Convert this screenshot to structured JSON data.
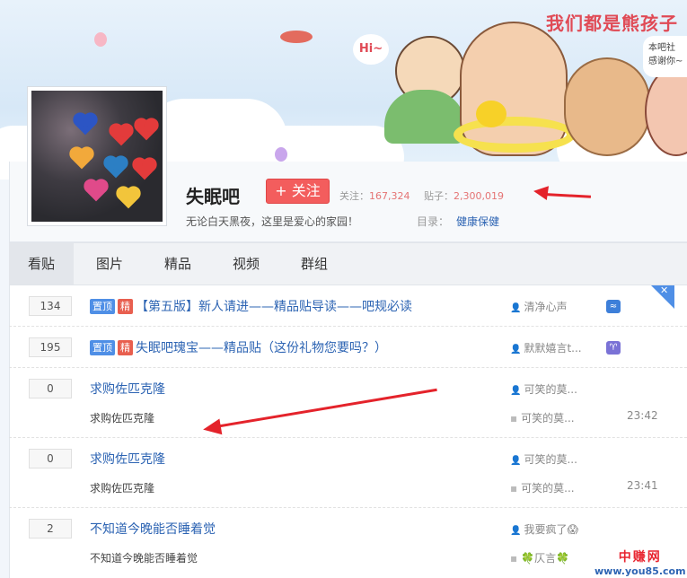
{
  "banner": {
    "title": "我们都是熊孩子",
    "bubble_line1": "本吧社",
    "bubble_line2": "感谢你~",
    "hi_text": "Hi~"
  },
  "forum": {
    "name": "失眠吧",
    "follow_label": "+ 关注",
    "followers_label": "关注：",
    "followers_value": "167,324",
    "posts_label": "贴子：",
    "posts_value": "2,300,019",
    "slogan": "无论白天黑夜，这里是爱心的家园！",
    "dir_label": "目录：",
    "dir_link": "健康保健"
  },
  "tabs": [
    {
      "label": "看贴",
      "active": true
    },
    {
      "label": "图片",
      "active": false
    },
    {
      "label": "精品",
      "active": false
    },
    {
      "label": "视频",
      "active": false
    },
    {
      "label": "群组",
      "active": false
    }
  ],
  "threads": [
    {
      "replies": "134",
      "tags": [
        "置顶",
        "精"
      ],
      "title": "【第五版】新人请进——精品贴导读——吧规必读",
      "author": "清净心声",
      "badge_icon": "wave-icon",
      "badge_color": "#3d7fd9",
      "badge_glyph": "≈"
    },
    {
      "replies": "195",
      "tags": [
        "置顶",
        "精"
      ],
      "title": "失眠吧瑰宝——精品贴（这份礼物您要吗？）",
      "author": "默默嬉言t...",
      "badge_icon": "aries-icon",
      "badge_color": "#7a72d6",
      "badge_glyph": "♈"
    },
    {
      "replies": "0",
      "title": "求购佐匹克隆",
      "abstract": "求购佐匹克隆",
      "author": "可笑的莫...",
      "last_reply": "可笑的莫...",
      "time": "23:42"
    },
    {
      "replies": "0",
      "title": "求购佐匹克隆",
      "abstract": "求购佐匹克隆",
      "author": "可笑的莫...",
      "last_reply": "可笑的莫...",
      "time": "23:41"
    },
    {
      "replies": "2",
      "title": "不知道今晚能否睡着觉",
      "abstract": "不知道今晚能否睡着觉",
      "author": "我要疯了😱",
      "last_reply": "🍀仄言🍀"
    }
  ],
  "watermark": {
    "line1": "中赚网",
    "line2": "www.you85.com"
  },
  "colors": {
    "accent": "#2d64b3",
    "follow": "#f35d5d",
    "tag_top": "#4f8fe6",
    "tag_good": "#e85f4f",
    "arrow": "#e4232b"
  }
}
